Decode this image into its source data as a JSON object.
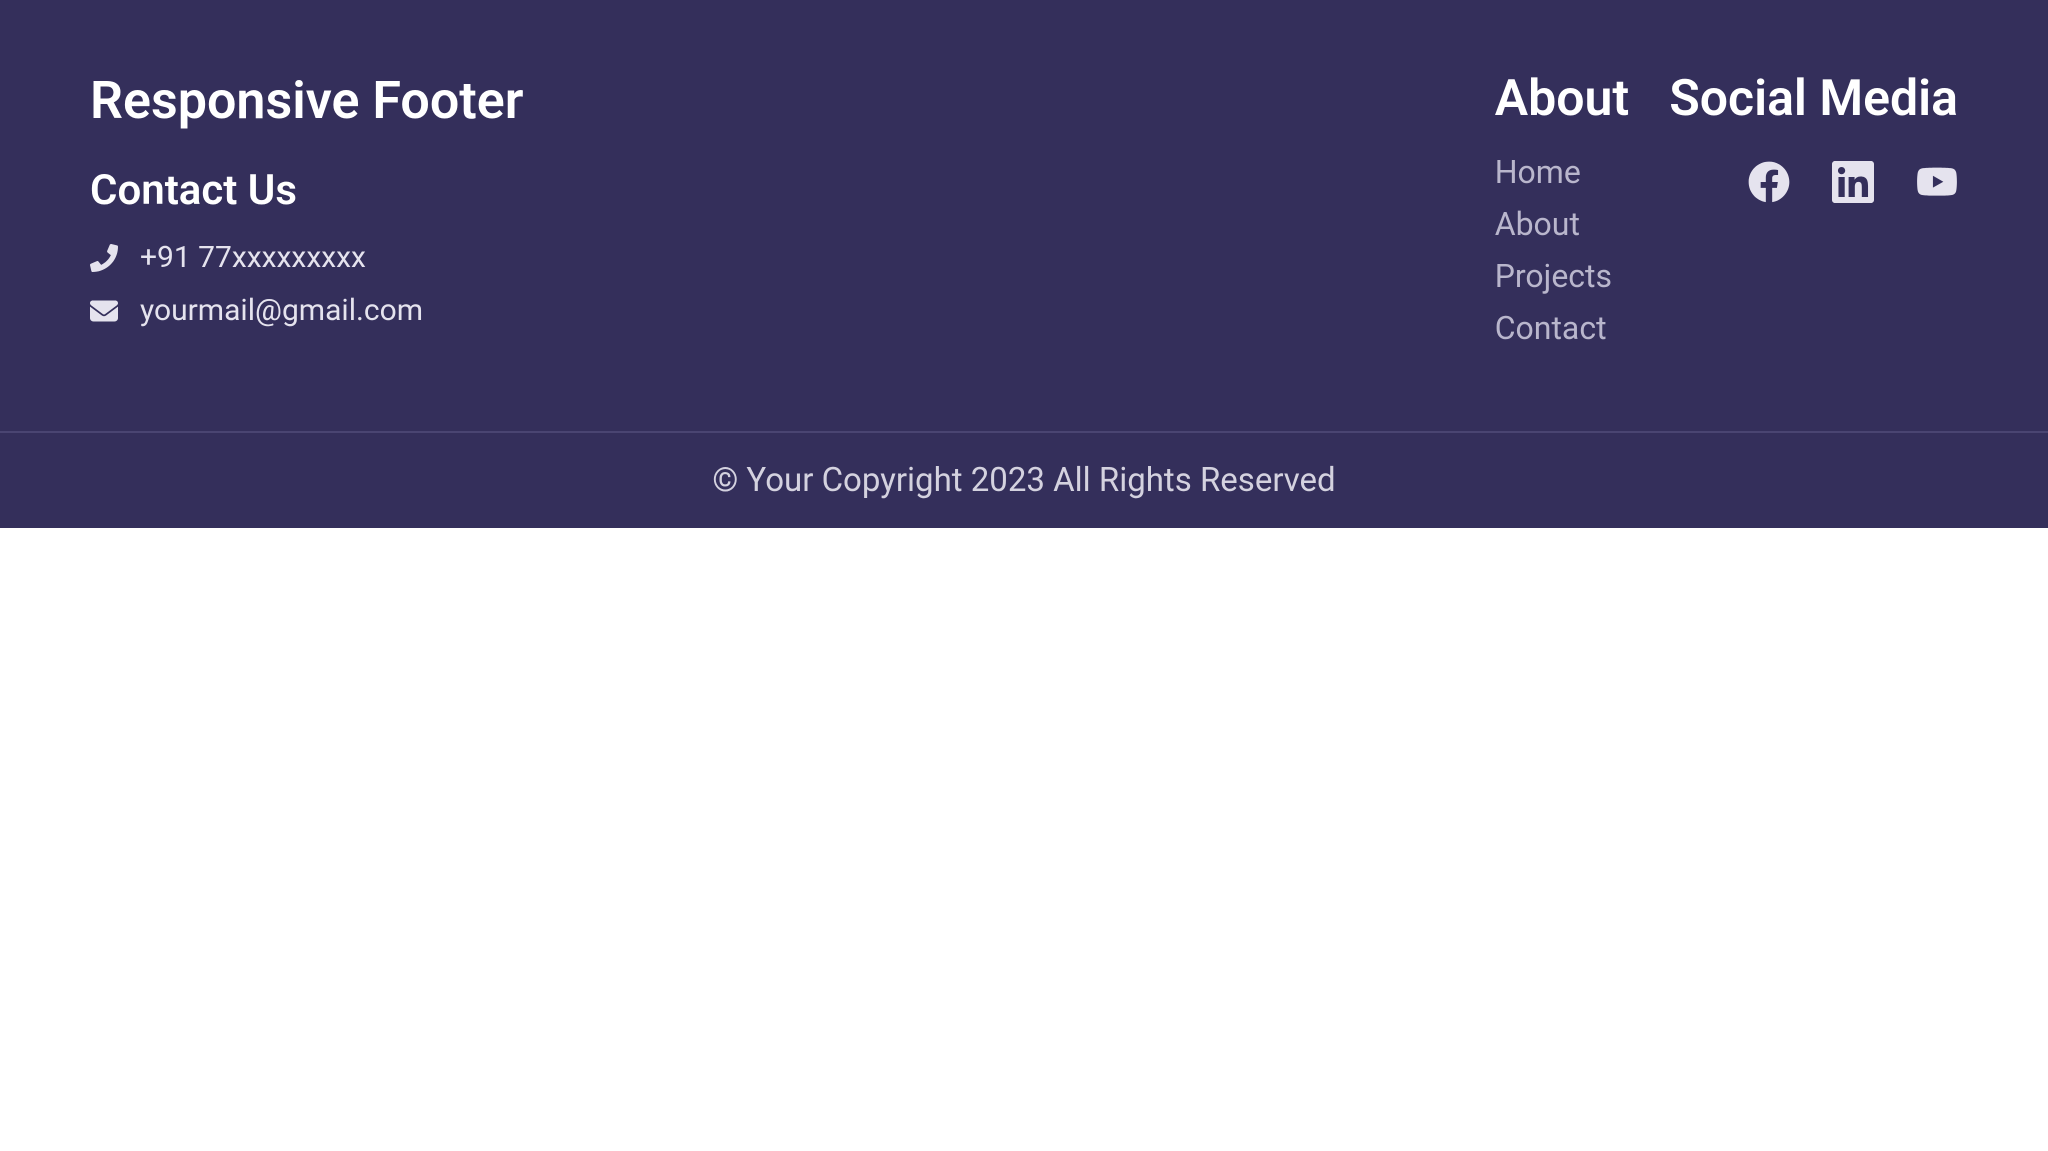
{
  "footer": {
    "title": "Responsive Footer",
    "contact": {
      "heading": "Contact Us",
      "phone": "+91 77xxxxxxxxx",
      "email": "yourmail@gmail.com"
    },
    "about": {
      "heading": "About",
      "links": [
        "Home",
        "About",
        "Projects",
        "Contact"
      ]
    },
    "social": {
      "heading": "Social Media"
    },
    "copyright": "© Your Copyright 2023 All Rights Reserved"
  }
}
